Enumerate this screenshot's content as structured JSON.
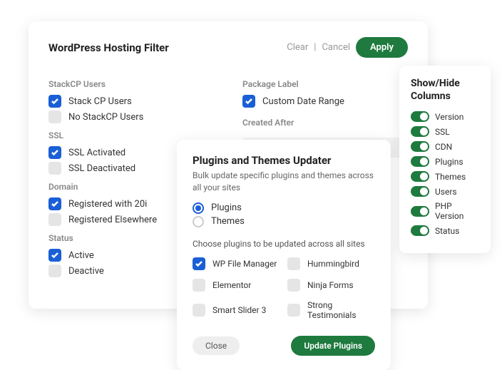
{
  "filter": {
    "title": "WordPress Hosting Filter",
    "clear": "Clear",
    "cancel": "Cancel",
    "apply": "Apply",
    "groups": {
      "stackcp": {
        "label": "StackCP Users",
        "items": [
          {
            "label": "Stack CP Users",
            "checked": true
          },
          {
            "label": "No StackCP Users",
            "checked": false
          }
        ]
      },
      "ssl": {
        "label": "SSL",
        "items": [
          {
            "label": "SSL Activated",
            "checked": true
          },
          {
            "label": "SSL Deactivated",
            "checked": false
          }
        ]
      },
      "domain": {
        "label": "Domain",
        "items": [
          {
            "label": "Registered with 20i",
            "checked": true
          },
          {
            "label": "Registered Elsewhere",
            "checked": false
          }
        ]
      },
      "status": {
        "label": "Status",
        "items": [
          {
            "label": "Active",
            "checked": true
          },
          {
            "label": "Deactive",
            "checked": false
          }
        ]
      },
      "package": {
        "label": "Package Label",
        "items": [
          {
            "label": "Custom Date Range",
            "checked": true
          }
        ]
      },
      "created": {
        "label": "Created After"
      }
    }
  },
  "updater": {
    "title": "Plugins and Themes Updater",
    "sub": "Bulk update specific plugins and themes across all your sites",
    "type": [
      {
        "label": "Plugins",
        "checked": true
      },
      {
        "label": "Themes",
        "checked": false
      }
    ],
    "choose": "Choose plugins to be updated across all sites",
    "plugins": [
      {
        "label": "WP File Manager",
        "checked": true
      },
      {
        "label": "Hummingbird",
        "checked": false
      },
      {
        "label": "Elementor",
        "checked": false
      },
      {
        "label": "Ninja Forms",
        "checked": false
      },
      {
        "label": "Smart Slider 3",
        "checked": false
      },
      {
        "label": "Strong Testimonials",
        "checked": false
      }
    ],
    "close": "Close",
    "update": "Update Plugins"
  },
  "cols": {
    "title": "Show/Hide Columns",
    "items": [
      {
        "label": "Version"
      },
      {
        "label": "SSL"
      },
      {
        "label": "CDN"
      },
      {
        "label": "Plugins"
      },
      {
        "label": "Themes"
      },
      {
        "label": "Users"
      },
      {
        "label": "PHP Version"
      },
      {
        "label": "Status"
      }
    ]
  }
}
